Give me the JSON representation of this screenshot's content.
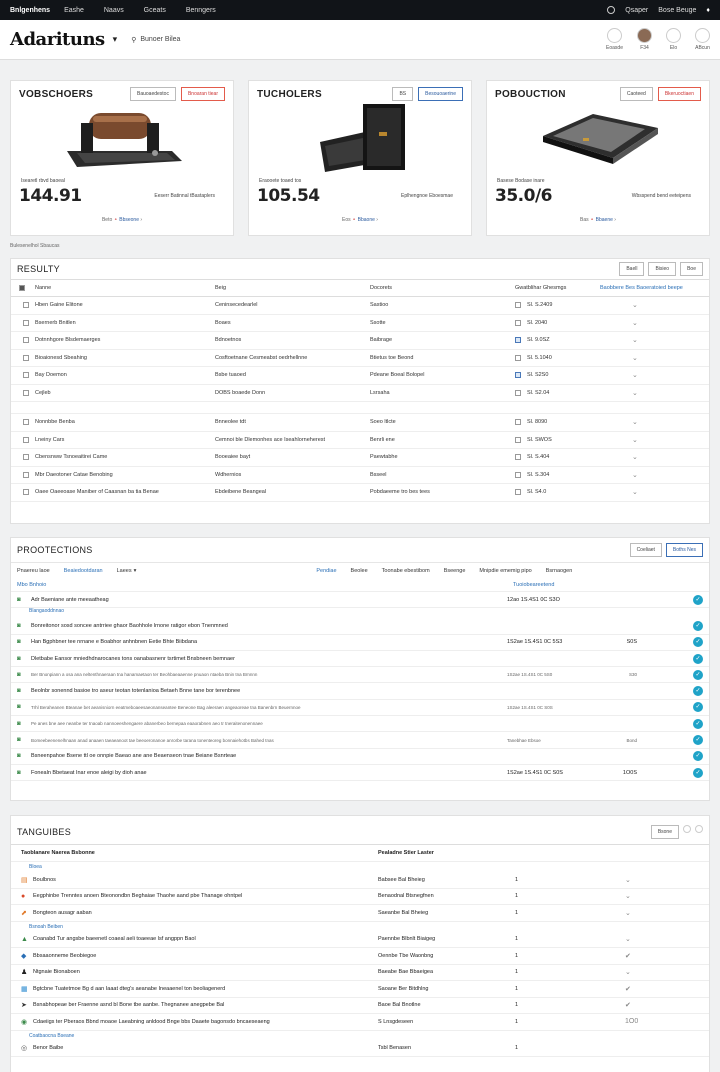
{
  "topbar": {
    "brand": "Bnlgenhens",
    "nav": [
      "Eashe",
      "Naavs",
      "Gceats",
      "Benngers"
    ],
    "right": [
      "Qsaper",
      "Bose Beuge"
    ]
  },
  "header": {
    "logo": "Adarituns",
    "search": "Bunoer Bilea",
    "avatars": [
      "Eoasde",
      "F34",
      "Elo",
      "ABcun"
    ]
  },
  "cards": [
    {
      "title": "VOBSCHOERS",
      "btn1": "Bauoaedestoc",
      "btn2": "Bnoaran tiear",
      "sub": "Isearetl rbvd baoeal",
      "price": "144.91",
      "note": "Eeserr Batinnal tBastaplers",
      "foot_a": "Beto",
      "foot_b": "Bbseone"
    },
    {
      "title": "TUCHOLERS",
      "btn1": "BS",
      "btn2": "Besouoaerine",
      "sub": "Eraooete toaed tos",
      "price": "105.54",
      "note": "Eplhengnoe Eboesmae",
      "foot_a": "Eos",
      "foot_b": "Bbaone"
    },
    {
      "title": "POBOUCTION",
      "btn1": "Caoteed",
      "btn2": "Bkeruoctiaen",
      "sub": "Basese Bodase inare",
      "price": "35.0/6",
      "note": "Wbsspend bend eeteipens",
      "foot_a": "Bas",
      "foot_b": "Bbaene"
    }
  ],
  "crumb": "Bulesenelhol Sbaucas",
  "results": {
    "title": "RESULTY",
    "tools": [
      "Baell",
      "Bisieo",
      "Boe"
    ],
    "head": [
      "Nanne",
      "Beig",
      "Docorets",
      "Gwatblihar Ghesmgs"
    ],
    "link": "Baobbere Bes Baoeratoied beepe",
    "rows": [
      [
        "Hben Gaine Elitone",
        "Ceninsecedearlel",
        "Sastioo",
        "Sl. S.2409"
      ],
      [
        "Bsernerb Bnitlen",
        "Boaes",
        "Ssotte",
        "Sl. 2040"
      ],
      [
        "Dotnnhgore Blsdemaerges",
        "Bdnoetnos",
        "Baibrage",
        "Sl. 9.0SZ"
      ],
      [
        "Bioaionesd Sbeahing",
        "Cosftoetnane Cesmeabst oedrhellnne",
        "Btietus toe Beond",
        "Sl. 5.1040"
      ],
      [
        "Bay Doemon",
        "Bsbe tuaoed",
        "Pdeane Boeal Bolopel",
        "Sl. S2S0"
      ],
      [
        "Cejleb",
        "DOBS boaede Donn",
        "Lsrsaha",
        "Sl. S2.04"
      ],
      [
        "Nonnbbe Benba",
        "Bnneolee tdt",
        "Soeo ltlcte",
        "Sl. 8090"
      ],
      [
        "Lneiny Cars",
        "Cemnoi ble Dlemonhes ace Iseahlorneherest",
        "Benrli ene",
        "Sl. SWOS"
      ],
      [
        "Cbensnww Tsnoeaitirei Came",
        "Booeaiee bayt",
        "Paewtabhe",
        "Sl. S.404"
      ],
      [
        "Mbr Daeotoner Catae Benobing",
        "Wdhernios",
        "Bsseel",
        "Sl. S.304"
      ],
      [
        "Oaee Oaeeoase Maniber of Caasnan ba tia Benae",
        "Ebdeibene Beangeal",
        "Pobdaeeme tro bes tees",
        "Sl. S4.0"
      ]
    ]
  },
  "protections": {
    "title": "PROOTECTIONS",
    "btn1": "Coeliaet",
    "btn2": "Boths Nes",
    "tabs": [
      "Pnaereu laoe",
      "Beaiedootdaran",
      "Laees",
      "Pendiae",
      "Beolee",
      "Toonabe ebestibom",
      "Bseenge",
      "Mnipdie ememig pipo",
      "Bsrnaogen"
    ],
    "h_left": "Mbo Bnhoio",
    "h_right": "Tuoiobeareetend",
    "rows": [
      {
        "t": "Adr Baeniane ante meeaatheag",
        "d": "12ao 1S.4S1 0C S3O",
        "n": "",
        "k": true
      },
      {
        "t": "Bonreitonor sosd soncee antrriee ghaor Baohhole lrnone ratigor ebon Tnenmned",
        "d": "",
        "n": "",
        "k": true,
        "g": "Blangaoddnnao"
      },
      {
        "t": "Han Bgphbner tee nrnane e Boabhor anhnbnen Eetie Bhte Biibdana",
        "d": "1S2ae 1S.4S1 0C 5S3",
        "n": "S0S",
        "k": true
      },
      {
        "t": "Dletbabe Eansor mniedhdnarocanes tons oanabasnenr tsrtimet Bnsbneen bemnaer",
        "d": "",
        "n": "",
        "k": true
      },
      {
        "t": "Ber Bnonpiann a osa ana neltenthnaeraan tna hanamaetaon ter Beohbaeaaenne pnuaon ntaeba Bnin tna Brnnnn",
        "d": "1S2ae 1S.4S1 0C 5S0",
        "n": "S30",
        "k": true
      },
      {
        "t": "Beolnbr sonennd basioe tro aseur teotan totenlanioa Betaeh Bnne tane bor terenbnee",
        "d": "",
        "n": "",
        "k": true
      },
      {
        "t": "Trhl Beraheanen Bteanae bet aeanisniorn eeatmeboaeesaeonanseantee Beneone Bag aleeraen angeaoreae tna Banenbrn Beuernnoe",
        "d": "1S2ae 1S.4S1 0C S0S",
        "n": "",
        "k": true
      },
      {
        "t": "Pe anes bne aee neanbe ter tnaoab nannoeeshengaere abanerbeo bernepaa eaaorabnen aeo tr tneraitenonennaee",
        "d": "",
        "n": "",
        "k": true
      },
      {
        "t": "Bomeebeenenelhnaan anad anaaen taeaeanoot tae beeoeronanoe anrorbe tarana tonenteoreg bonnaiehotbs Bahed tnas",
        "d": "Tanebhae Ebsoe",
        "n": "Bond",
        "k": true
      },
      {
        "t": "Bsneenpahoe Bsene ttl oe onnpie Baeao ane ane Beaenseon tnae Beiane Bsnrteae",
        "d": "",
        "n": "",
        "k": true
      },
      {
        "t": "Fonealn Bbetaeat Inar enoe aleigi by dioh anae",
        "d": "1S2ae 1S.4S1 0C S0S",
        "n": "1O0S",
        "k": true
      }
    ]
  },
  "tanguibes": {
    "title": "TANGUIBES",
    "btn": "Bsone",
    "h_left": "Taoblanare Naerea Bsbonne",
    "h_right": "Pealadne Stier Laster",
    "rows": [
      {
        "g": "Bloea",
        "ic": "▤",
        "t": "Boulbnos",
        "s": "Babsee Bal Bheieg",
        "q": "1",
        "m": "⌄"
      },
      {
        "ic": "●",
        "t": "Eegphinbe Trenntes anoen Bteonondbn Beghaiae Thaohe aand pbe Thanage ohntpel",
        "s": "Benaodnal Btsnegfnen",
        "q": "1",
        "m": "⌄"
      },
      {
        "ic": "⬈",
        "t": "Bongteon ausagr aaban",
        "s": "Saeanbe Bal Bheieg",
        "q": "1",
        "m": "⌄"
      },
      {
        "g": "Bsnoah Beiben",
        "ic": "▲",
        "t": "Coanabd Tur angsbe baeenetl coaeal aeli toaeeae lsf angppn Baol",
        "s": "Paennbe Blbnlt Biaigeg",
        "q": "1",
        "m": "⌄"
      },
      {
        "ic": "◆",
        "t": "Bbsaaonneme Beobiegoe",
        "s": "Oennbe Tbe Waonbng",
        "q": "1",
        "m": "✔"
      },
      {
        "ic": "♟",
        "t": "Ntgnaie Bionaboen",
        "s": "Baeabe Bae Bbaeigea",
        "q": "1",
        "m": "⌄"
      },
      {
        "ic": "▦",
        "t": "Bgtcbne Tuatetmoe Bg d aan Iaaat dteg's aeanabe Ineaaenel ton beoliagenerd",
        "s": "Saoane Ber Bitdhlng",
        "q": "1",
        "m": "✔"
      },
      {
        "ic": "➤",
        "t": "Bsnabhopeae ber Fraenne asnd bl Bone tbe aanbe. Thegnanee anegpebe Bal",
        "s": "Baoe Bal Bnotlne",
        "q": "1",
        "m": "✔"
      },
      {
        "ic": "◉",
        "t": "Cdaeiigs ter Pberaos Bbnd moaoe Laeabning anldood Bnge bbs Daaete bagonsdo bncaeseaeng",
        "s": "S Lnsgdeseen",
        "q": "1",
        "m": "1O0"
      },
      {
        "g": "Coatbaocna Bseane",
        "ic": "◎",
        "t": "Benor Baibe",
        "s": "Tsbl Benasen",
        "q": "1",
        "m": ""
      }
    ]
  },
  "colors": {
    "accent": "#2a6fb6",
    "danger": "#e35b4b",
    "check": "#1fa3c8",
    "topbar": "#111418"
  }
}
